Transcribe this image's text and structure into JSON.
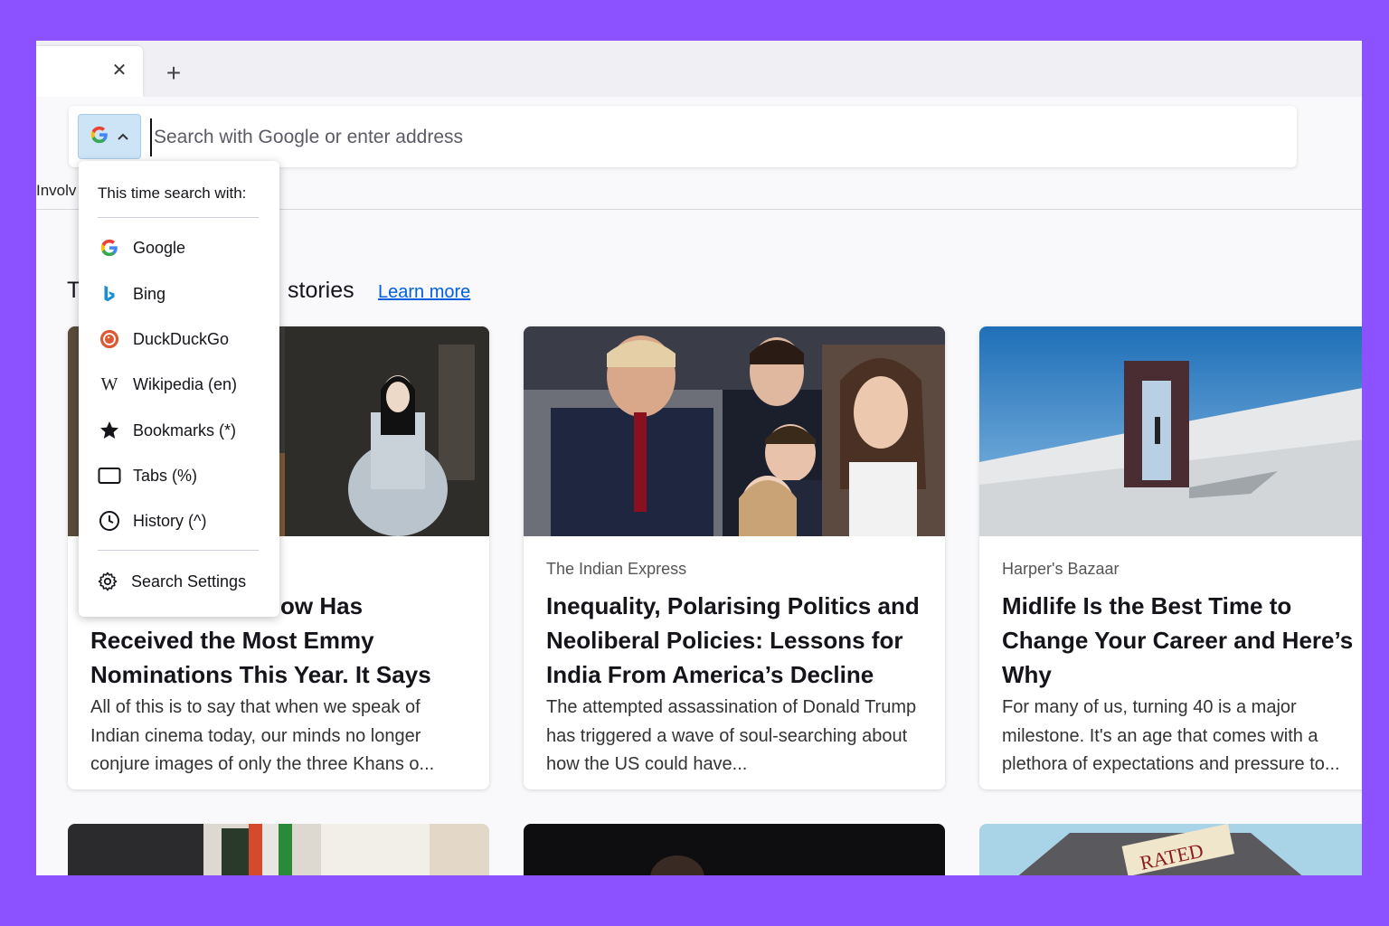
{
  "tabs": {
    "close_glyph": "✕",
    "new_tab_glyph": "+"
  },
  "urlbar": {
    "placeholder": "Search with Google or enter address",
    "engine": "Google"
  },
  "bookmarks_fragment": "Involv",
  "search_menu": {
    "header": "This time search with:",
    "engines": [
      {
        "label": "Google",
        "icon": "google-icon"
      },
      {
        "label": "Bing",
        "icon": "bing-icon"
      },
      {
        "label": "DuckDuckGo",
        "icon": "duckduckgo-icon"
      },
      {
        "label": "Wikipedia (en)",
        "icon": "wikipedia-icon"
      },
      {
        "label": "Bookmarks (*)",
        "icon": "star-icon"
      },
      {
        "label": "Tabs (%)",
        "icon": "tab-icon"
      },
      {
        "label": "History (^)",
        "icon": "clock-icon"
      }
    ],
    "settings": "Search Settings"
  },
  "stories": {
    "title_start": "T",
    "title_end": "stories",
    "learn_more": "Learn more",
    "cards": [
      {
        "source": "",
        "title_line1": "ow Has",
        "title_rest": "Received the Most Emmy Nominations This Year. It Says a...",
        "excerpt": "All of this is to say that when we speak of Indian cinema today, our minds no longer conjure images of only the three Khans o..."
      },
      {
        "source": "The Indian Express",
        "title": "Inequality, Polarising Politics and Neoliberal Policies: Lessons for India From America’s Decline",
        "excerpt": "The attempted assassination of Donald Trump has triggered a wave of soul-searching about how the US could have..."
      },
      {
        "source": "Harper's Bazaar",
        "title": "Midlife Is the Best Time to Change Your Career and Here’s Why",
        "excerpt": "For many of us, turning 40 is a major milestone. It's an age that comes with a plethora of expectations and pressure to..."
      }
    ],
    "card_art_text": "RATED"
  },
  "colors": {
    "frame": "#8c52ff",
    "link": "#0060df",
    "engine_highlight": "#cde4f7"
  }
}
